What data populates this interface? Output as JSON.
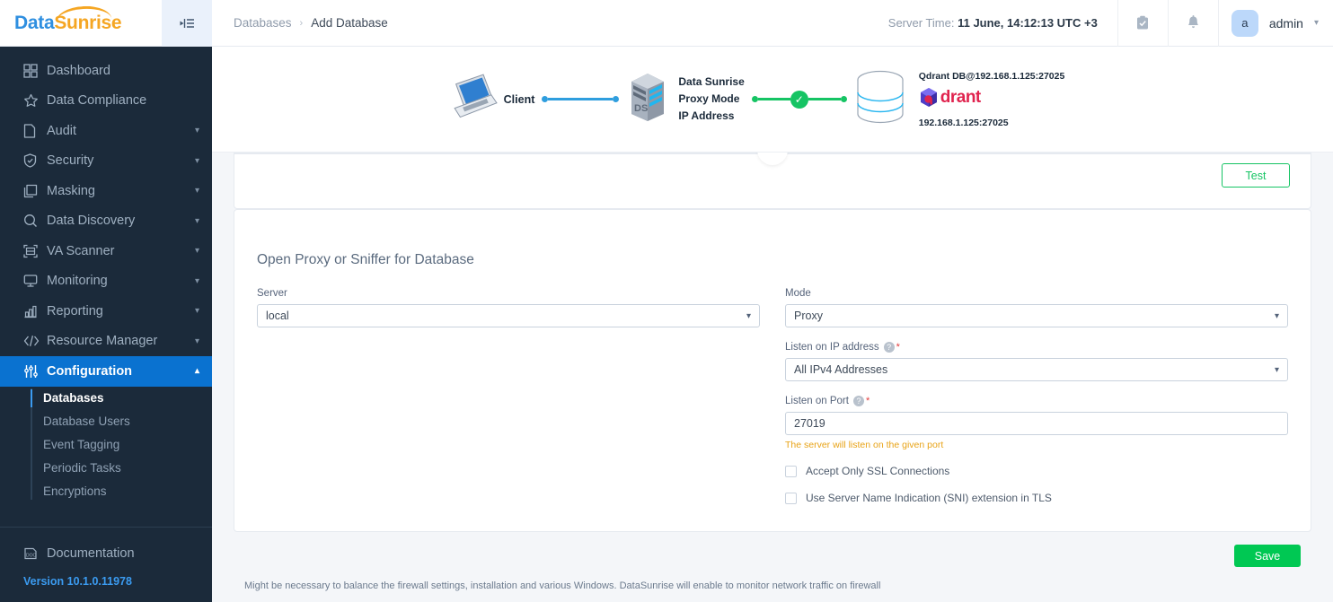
{
  "brand": {
    "name_part1": "Data",
    "name_part2": "Sunrise"
  },
  "sidebar": {
    "items": [
      {
        "label": "Dashboard",
        "icon": "grid-icon",
        "expandable": false
      },
      {
        "label": "Data Compliance",
        "icon": "star-icon",
        "expandable": false
      },
      {
        "label": "Audit",
        "icon": "document-icon",
        "expandable": true
      },
      {
        "label": "Security",
        "icon": "shield-check-icon",
        "expandable": true
      },
      {
        "label": "Masking",
        "icon": "layers-icon",
        "expandable": true
      },
      {
        "label": "Data Discovery",
        "icon": "magnifier-icon",
        "expandable": true
      },
      {
        "label": "VA Scanner",
        "icon": "scan-icon",
        "expandable": true
      },
      {
        "label": "Monitoring",
        "icon": "monitor-icon",
        "expandable": true
      },
      {
        "label": "Reporting",
        "icon": "bar-chart-icon",
        "expandable": true
      },
      {
        "label": "Resource Manager",
        "icon": "code-icon",
        "expandable": true
      },
      {
        "label": "Configuration",
        "icon": "sliders-icon",
        "expandable": true,
        "active": true
      }
    ],
    "submenu": [
      {
        "label": "Databases",
        "active": true
      },
      {
        "label": "Database Users",
        "active": false
      },
      {
        "label": "Event Tagging",
        "active": false
      },
      {
        "label": "Periodic Tasks",
        "active": false
      },
      {
        "label": "Encryptions",
        "active": false
      }
    ],
    "documentation_label": "Documentation",
    "version_label": "Version",
    "version_value": "10.1.0.11978"
  },
  "topbar": {
    "breadcrumb_root": "Databases",
    "breadcrumb_sep": "›",
    "breadcrumb_current": "Add Database",
    "server_time_label": "Server Time:",
    "server_time_value": "11 June, 14:12:13  UTC +3",
    "tasks_icon": "clipboard-check-icon",
    "bell_icon": "bell-icon",
    "avatar_initial": "a",
    "username": "admin"
  },
  "diagram": {
    "client_label": "Client",
    "proxy_lines": [
      "Data Sunrise",
      "Proxy Mode",
      "IP Address"
    ],
    "db_title": "Qdrant DB@192.168.1.125:27025",
    "db_logo_word": "drant",
    "db_endpoint": "192.168.1.125:27025",
    "connection_ok_icon": "check-circle-icon"
  },
  "card_top": {
    "collapse_icon": "chevron-up-icon",
    "test_button": "Test"
  },
  "form": {
    "section_title": "Open Proxy or Sniffer for Database",
    "server": {
      "label": "Server",
      "value": "local"
    },
    "mode": {
      "label": "Mode",
      "value": "Proxy"
    },
    "listen_ip": {
      "label": "Listen on IP address",
      "help": "?",
      "required": "*",
      "value": "All IPv4 Addresses"
    },
    "listen_port": {
      "label": "Listen on Port",
      "help": "?",
      "required": "*",
      "value": "27019",
      "hint": "The server will listen on the given port"
    },
    "checkbox_ssl": "Accept Only SSL Connections",
    "checkbox_sni": "Use Server Name Indication (SNI) extension in TLS",
    "save_button": "Save"
  },
  "footer": {
    "note": "Might be necessary to balance the firewall settings, installation and various Windows. DataSunrise will enable to monitor network traffic on firewall"
  },
  "colors": {
    "sidebar_bg": "#1b2a3a",
    "active_blue": "#0a72d0",
    "accent_green": "#00c853",
    "link_blue": "#2f8fe0",
    "warning_orange": "#e8a317",
    "brand_orange": "#f5a623",
    "qdrant_red": "#e0234e"
  }
}
